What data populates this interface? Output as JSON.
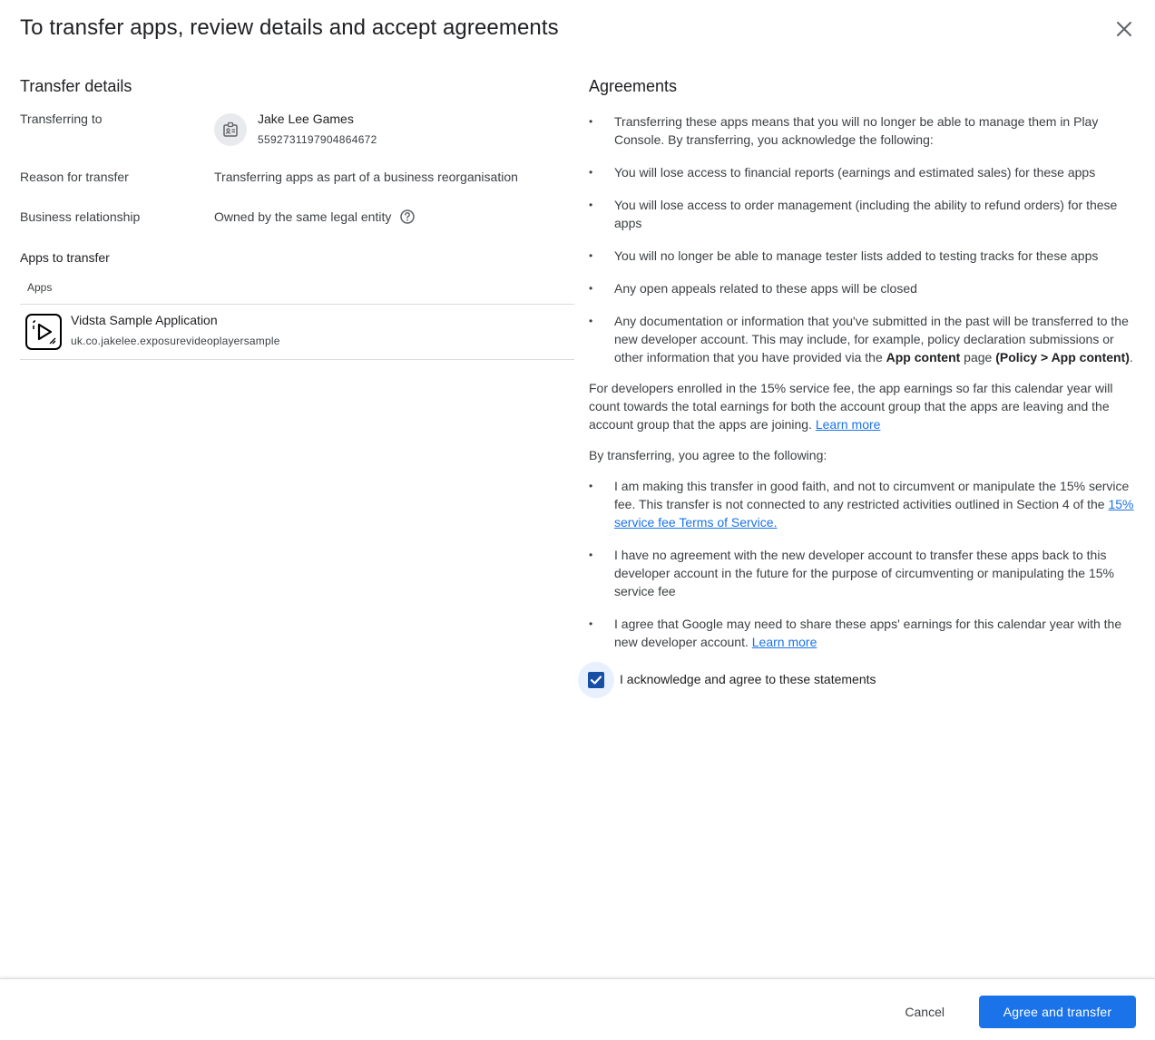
{
  "dialog": {
    "title": "To transfer apps, review details and accept agreements",
    "close_icon": "close-icon"
  },
  "transfer_details": {
    "title": "Transfer details",
    "to_label": "Transferring to",
    "developer_name": "Jake Lee Games",
    "developer_id": "5592731197904864672",
    "reason_label": "Reason for transfer",
    "reason_value": "Transferring apps as part of a business reorganisation",
    "relationship_label": "Business relationship",
    "relationship_value": "Owned by the same legal entity",
    "help_icon": "help-icon"
  },
  "apps": {
    "title": "Apps to transfer",
    "column_header": "Apps",
    "items": [
      {
        "name": "Vidsta Sample Application",
        "package": "uk.co.jakelee.exposurevideoplayersample"
      }
    ]
  },
  "agreements": {
    "title": "Agreements",
    "bullets_1": [
      "Transferring these apps means that you will no longer be able to manage them in Play Console. By transferring, you acknowledge the following:",
      "You will lose access to financial reports (earnings and estimated sales) for these apps",
      "You will lose access to order management (including the ability to refund orders) for these apps",
      "You will no longer be able to manage tester lists added to testing tracks for these apps",
      "Any open appeals related to these apps will be closed"
    ],
    "docs_bullet_prefix": "Any documentation or information that you've submitted in the past will be transferred to the new developer account. This may include, for example, policy declaration submissions or other information that you have provided via the ",
    "docs_bullet_bold1": "App content",
    "docs_bullet_middle": " page ",
    "docs_bullet_bold2": "(Policy > App content)",
    "docs_bullet_suffix": ".",
    "fee_paragraph": "For developers enrolled in the 15% service fee, the app earnings so far this calendar year will count towards the total earnings for both the account group that the apps are leaving and the account group that the apps are joining. ",
    "learn_more": "Learn more",
    "agree_intro": "By transferring, you agree to the following:",
    "faith_bullet_prefix": "I am making this transfer in good faith, and not to circumvent or manipulate the 15% service fee. This transfer is not connected to any restricted activities outlined in Section 4 of the ",
    "faith_bullet_link": "15% service fee Terms of Service.",
    "no_agreement_bullet": "I have no agreement with the new developer account to transfer these apps back to this developer account in the future for the purpose of circumventing or manipulating the 15% service fee",
    "share_bullet_prefix": "I agree that Google may need to share these apps' earnings for this calendar year with the new developer account. ",
    "share_learn_more": "Learn more",
    "acknowledge_label": "I acknowledge and agree to these statements",
    "acknowledge_checked": true
  },
  "footer": {
    "cancel_label": "Cancel",
    "agree_label": "Agree and transfer"
  },
  "colors": {
    "primary": "#1a73e8",
    "checkbox": "#174ea6",
    "text": "#3c4043",
    "divider": "#dadce0"
  }
}
